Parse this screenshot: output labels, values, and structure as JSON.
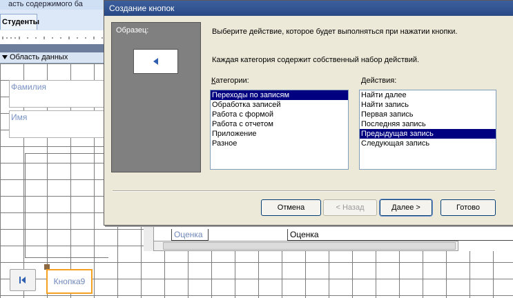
{
  "background": {
    "header_fragment": "асть содержимого ба",
    "form_tab": "Студенты",
    "section_label": "Область данных",
    "field_surname": "Фамилия",
    "field_name": "Имя",
    "subform_label": "Оценка",
    "subform_field": "Оценка",
    "button_caption": "Кнопка9"
  },
  "dialog": {
    "title": "Создание кнопок",
    "preview_label": "Образец:",
    "instruction_1": "Выберите действие, которое будет выполняться при нажатии кнопки.",
    "instruction_2": "Каждая категория содержит собственный набор действий.",
    "categories_label": "Категории:",
    "actions_label": "Действия:",
    "categories": [
      "Переходы по записям",
      "Обработка записей",
      "Работа с формой",
      "Работа с отчетом",
      "Приложение",
      "Разное"
    ],
    "categories_selected": "Переходы по записям",
    "actions": [
      "Найти далее",
      "Найти запись",
      "Первая запись",
      "Последняя запись",
      "Предыдущая запись",
      "Следующая запись"
    ],
    "actions_selected": "Предыдущая запись",
    "buttons": {
      "cancel": "Отмена",
      "back": "< Назад",
      "next": "Далее >",
      "finish": "Готово"
    }
  }
}
